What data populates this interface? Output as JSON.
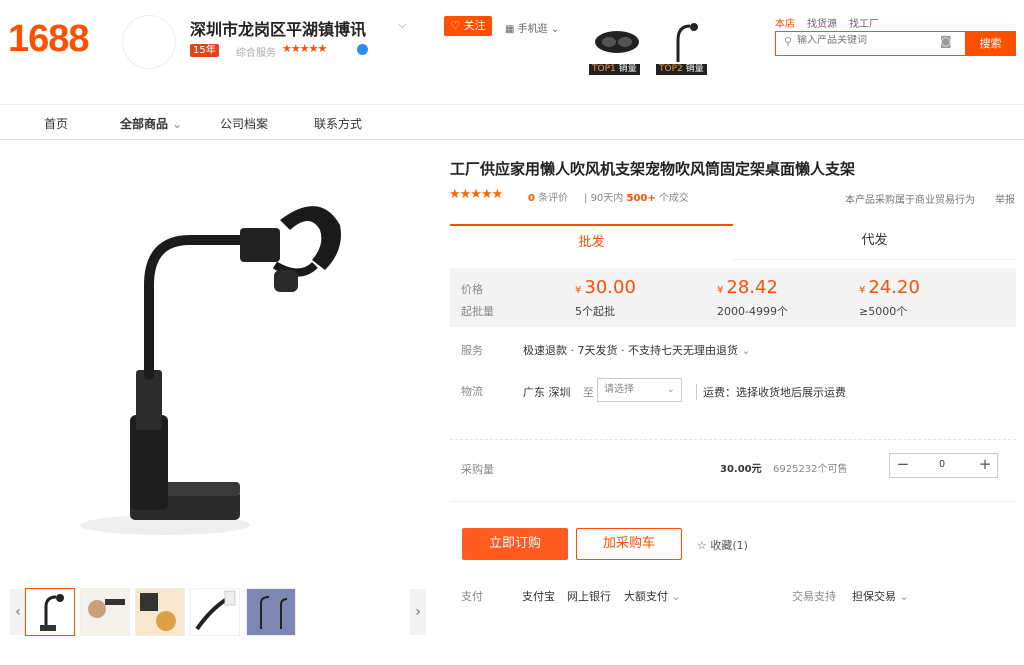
{
  "header": {
    "logo_text": "1688",
    "shop_name": "深圳市龙岗区平湖镇博讯",
    "years_badge": "15年",
    "score_label": "综合服务",
    "score_stars": "★★★★★",
    "follow_label": "♡ 关注",
    "mobile_label": "手机逛",
    "top_badges": [
      {
        "rank": "TOP1",
        "label": "销量"
      },
      {
        "rank": "TOP2",
        "label": "销量"
      }
    ],
    "search_tabs": [
      "本店",
      "找货源",
      "找工厂"
    ],
    "search_placeholder": "输入产品关键词",
    "search_button": "搜索"
  },
  "nav": {
    "items": [
      "首页",
      "全部商品",
      "公司档案",
      "联系方式"
    ]
  },
  "gallery": {
    "thumb_count": 5
  },
  "product": {
    "title": "工厂供应家用懒人吹风机支架宠物吹风筒固定架桌面懒人支架",
    "rating_stars": "★★★★★",
    "review_count": "0",
    "review_suffix": "条评价",
    "sales_prefix": "90天内",
    "sales_count": "500+",
    "sales_suffix": "个成交",
    "trade_note": "本产品采购属于商业贸易行为",
    "report_label": "举报"
  },
  "tabs": {
    "wholesale": "批发",
    "dropship": "代发"
  },
  "pricing": {
    "price_label": "价格",
    "moq_label": "起批量",
    "currency": "¥",
    "tiers": [
      {
        "price": "30.00",
        "qty": "5个起批"
      },
      {
        "price": "28.42",
        "qty": "2000-4999个"
      },
      {
        "price": "24.20",
        "qty": "≥5000个"
      }
    ]
  },
  "service": {
    "label": "服务",
    "value": "极速退款 · 7天发货 · 不支持七天无理由退货"
  },
  "logistics": {
    "label": "物流",
    "from": "广东 深圳",
    "to_label": "至",
    "region_placeholder": "请选择",
    "shipping": "运费：选择收货地后展示运费"
  },
  "purchase": {
    "qty_label": "采购量",
    "unit_price": "30.00元",
    "stock": "6925232个可售",
    "quantity": "0",
    "minus": "−",
    "plus": "+",
    "buy_button": "立即订购",
    "cart_button": "加采购车",
    "favorite_label": "收藏(1)"
  },
  "payment": {
    "label": "支付",
    "methods": [
      "支付宝",
      "网上银行",
      "大额支付"
    ],
    "trade_label": "交易支持",
    "trade_value": "担保交易"
  },
  "colors": {
    "accent": "#ff5000"
  }
}
